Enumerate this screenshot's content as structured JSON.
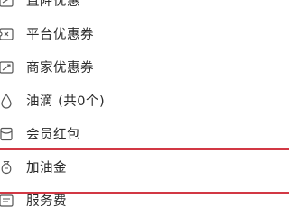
{
  "menu": {
    "items": [
      {
        "label": "直降优惠",
        "icon": "discount-icon"
      },
      {
        "label": "平台优惠券",
        "icon": "coupon-icon"
      },
      {
        "label": "商家优惠券",
        "icon": "merchant-coupon-icon"
      },
      {
        "label": "油滴 (共0个)",
        "icon": "oil-drop-icon"
      },
      {
        "label": "会员红包",
        "icon": "member-red-packet-icon"
      },
      {
        "label": "加油金",
        "icon": "fuel-money-bag-icon"
      },
      {
        "label": "服务费",
        "icon": "service-fee-icon"
      }
    ],
    "highlighted_item": "加油金",
    "highlight_color": "#d23844"
  }
}
